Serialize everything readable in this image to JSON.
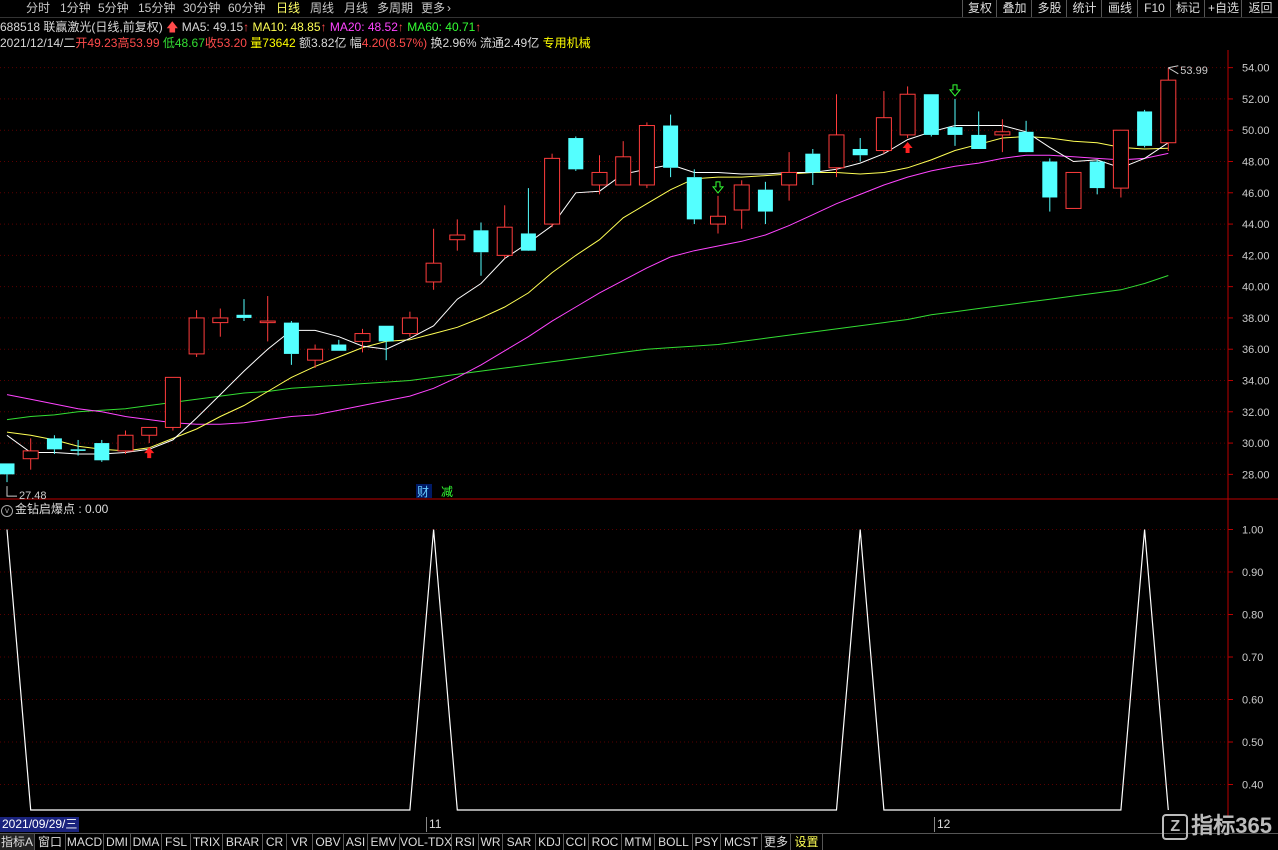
{
  "topbar": {
    "timeframes": [
      "分时",
      "1分钟",
      "5分钟",
      "15分钟",
      "30分钟",
      "60分钟",
      "日线",
      "周线",
      "月线",
      "多周期",
      "更多"
    ],
    "active_timeframe": "日线",
    "right_buttons": [
      "复权",
      "叠加",
      "多股",
      "统计",
      "画线",
      "F10",
      "标记",
      "+自选",
      "返回"
    ]
  },
  "info": {
    "code_name": "688518 联赢激光(日线,前复权)",
    "ma5": "MA5: 49.15",
    "ma10": "MA10: 48.85",
    "ma20": "MA20: 48.52",
    "ma60": "MA60: 40.71",
    "date": "2021/12/14/二",
    "open_label": "开",
    "open": "49.23",
    "high_label": "高",
    "high": "53.99",
    "low_label": "低",
    "low": "48.67",
    "close_label": "收",
    "close": "53.20",
    "vol_label": "量",
    "vol": "73642",
    "amt_label": "额",
    "amt": "3.82亿",
    "chg_label": "幅",
    "chg": "4.20(8.57%)",
    "turn_label": "换",
    "turn": "2.96%",
    "float_label": "流通",
    "float": "2.49亿",
    "industry": "专用机械"
  },
  "markers": {
    "cai": "财",
    "jian": "减",
    "max_label": "53.99",
    "min_label": "27.48"
  },
  "indicator": {
    "title": "金钻启爆点 : 0.00"
  },
  "datebar": {
    "start_date": "2021/09/29/三",
    "month_11": "11",
    "month_12": "12"
  },
  "bottombar": {
    "tabs": [
      "指标A",
      "窗口",
      "MACD",
      "DMI",
      "DMA",
      "FSL",
      "TRIX",
      "BRAR",
      "CR",
      "VR",
      "OBV",
      "ASI",
      "EMV",
      "VOL-TDX",
      "RSI",
      "WR",
      "SAR",
      "KDJ",
      "CCI",
      "ROC",
      "MTM",
      "BOLL",
      "PSY",
      "MCST",
      "更多",
      "设置"
    ],
    "watermark": "指标365"
  },
  "colors": {
    "up": "#ff3c3c",
    "down": "#54ffff",
    "ma5": "#ffffff",
    "ma10": "#ffff55",
    "ma20": "#ff44ff",
    "ma60": "#33dd33"
  },
  "chart_data": [
    {
      "type": "candlestick",
      "ylim": [
        27,
        55
      ],
      "yticks": [
        "28.00",
        "30.00",
        "32.00",
        "34.00",
        "36.00",
        "38.00",
        "40.00",
        "42.00",
        "44.00",
        "46.00",
        "48.00",
        "50.00",
        "52.00",
        "54.00"
      ],
      "candles": [
        [
          28.7,
          28.7,
          27.5,
          28.0
        ],
        [
          29.0,
          30.3,
          28.3,
          29.5
        ],
        [
          30.3,
          30.5,
          29.3,
          29.6
        ],
        [
          29.6,
          30.2,
          29.2,
          29.5
        ],
        [
          30.0,
          30.2,
          28.8,
          28.9
        ],
        [
          29.5,
          30.8,
          29.3,
          30.5
        ],
        [
          30.5,
          31.0,
          30.0,
          31.0
        ],
        [
          31.0,
          34.2,
          30.8,
          34.2
        ],
        [
          35.7,
          38.5,
          35.5,
          38.0
        ],
        [
          37.7,
          38.6,
          36.8,
          38.0
        ],
        [
          38.2,
          39.2,
          37.8,
          38.0
        ],
        [
          37.7,
          39.4,
          36.5,
          37.8
        ],
        [
          37.7,
          37.8,
          35.0,
          35.7
        ],
        [
          35.3,
          36.3,
          34.8,
          36.0
        ],
        [
          36.3,
          36.6,
          35.9,
          35.9
        ],
        [
          36.5,
          37.3,
          35.8,
          37.0
        ],
        [
          37.5,
          37.5,
          35.3,
          36.5
        ],
        [
          37.0,
          38.4,
          36.8,
          38.0
        ],
        [
          40.3,
          43.7,
          39.8,
          41.5
        ],
        [
          43.0,
          44.3,
          42.3,
          43.3
        ],
        [
          43.6,
          44.1,
          40.7,
          42.2
        ],
        [
          42.0,
          45.2,
          41.8,
          43.8
        ],
        [
          43.4,
          46.3,
          42.8,
          42.3
        ],
        [
          44.0,
          48.5,
          43.8,
          48.2
        ],
        [
          49.5,
          49.6,
          47.4,
          47.5
        ],
        [
          46.5,
          48.4,
          45.9,
          47.3
        ],
        [
          46.5,
          49.3,
          46.5,
          48.3
        ],
        [
          46.5,
          50.5,
          46.3,
          50.3
        ],
        [
          50.3,
          51.0,
          47.0,
          47.6
        ],
        [
          47.0,
          47.5,
          44.0,
          44.3
        ],
        [
          44.0,
          45.8,
          43.4,
          44.5
        ],
        [
          44.9,
          46.8,
          43.7,
          46.5
        ],
        [
          46.2,
          46.7,
          44.0,
          44.8
        ],
        [
          46.5,
          48.6,
          45.5,
          47.3
        ],
        [
          48.5,
          48.8,
          46.5,
          47.3
        ],
        [
          47.6,
          52.3,
          47.0,
          49.7
        ],
        [
          48.8,
          49.5,
          48.0,
          48.4
        ],
        [
          48.7,
          52.5,
          48.5,
          50.8
        ],
        [
          49.7,
          52.8,
          49.5,
          52.3
        ],
        [
          52.3,
          52.3,
          49.6,
          49.7
        ],
        [
          50.2,
          52.0,
          49.0,
          49.7
        ],
        [
          49.7,
          51.2,
          49.0,
          48.8
        ],
        [
          49.7,
          50.7,
          48.6,
          49.9
        ],
        [
          49.9,
          50.6,
          48.7,
          48.6
        ],
        [
          48.0,
          48.2,
          44.8,
          45.7
        ],
        [
          45.0,
          47.3,
          45.0,
          47.3
        ],
        [
          48.0,
          48.1,
          45.9,
          46.3
        ],
        [
          46.3,
          50.0,
          45.7,
          50.0
        ],
        [
          51.2,
          51.3,
          48.9,
          49.0
        ],
        [
          49.2,
          53.99,
          48.67,
          53.2
        ]
      ],
      "ma5": [
        30.5,
        29.4,
        29.4,
        29.3,
        29.3,
        29.4,
        29.6,
        30.2,
        31.6,
        33.1,
        34.6,
        36.0,
        37.2,
        37.2,
        36.8,
        36.2,
        36.0,
        36.7,
        37.5,
        39.2,
        40.2,
        41.8,
        42.8,
        43.9,
        46.0,
        46.1,
        47.2,
        47.5,
        47.8,
        47.3,
        47.3,
        47.2,
        47.2,
        47.3,
        47.3,
        47.5,
        47.9,
        48.5,
        49.4,
        49.9,
        50.3,
        50.3,
        50.3,
        49.9,
        48.9,
        48.0,
        48.1,
        47.6,
        48.2,
        49.2
      ],
      "ma10": [
        30.7,
        30.5,
        30.2,
        29.8,
        29.6,
        29.5,
        29.7,
        30.3,
        30.9,
        31.7,
        32.4,
        33.3,
        34.2,
        34.9,
        35.5,
        36.1,
        36.5,
        36.6,
        37.0,
        37.4,
        38.0,
        38.7,
        39.6,
        40.9,
        42.0,
        43.0,
        44.4,
        45.3,
        46.2,
        46.9,
        47.0,
        47.0,
        47.1,
        47.2,
        47.3,
        47.3,
        47.2,
        47.3,
        47.6,
        48.1,
        48.7,
        49.1,
        49.5,
        49.6,
        49.5,
        49.3,
        49.2,
        48.9,
        48.8,
        48.85
      ],
      "ma20": [
        33.1,
        32.8,
        32.5,
        32.2,
        32.0,
        31.7,
        31.5,
        31.3,
        31.2,
        31.2,
        31.3,
        31.5,
        31.7,
        31.8,
        32.1,
        32.4,
        32.7,
        33.0,
        33.5,
        34.2,
        35.0,
        35.9,
        36.8,
        37.8,
        38.7,
        39.6,
        40.4,
        41.2,
        41.9,
        42.3,
        42.6,
        42.9,
        43.3,
        43.9,
        44.6,
        45.3,
        45.9,
        46.5,
        47.0,
        47.4,
        47.7,
        47.9,
        48.2,
        48.4,
        48.4,
        48.3,
        48.2,
        48.1,
        48.2,
        48.52
      ],
      "ma60": [
        31.5,
        31.7,
        31.8,
        32.0,
        32.1,
        32.2,
        32.4,
        32.6,
        32.8,
        33.0,
        33.2,
        33.3,
        33.5,
        33.6,
        33.7,
        33.8,
        33.9,
        34.0,
        34.2,
        34.4,
        34.6,
        34.8,
        35.0,
        35.2,
        35.4,
        35.6,
        35.8,
        36.0,
        36.1,
        36.2,
        36.3,
        36.5,
        36.7,
        36.9,
        37.1,
        37.3,
        37.5,
        37.7,
        37.9,
        38.2,
        38.4,
        38.6,
        38.8,
        39.0,
        39.2,
        39.4,
        39.6,
        39.8,
        40.2,
        40.71
      ],
      "up_arrows": [
        6,
        38
      ],
      "down_arrows": [
        30,
        40
      ]
    },
    {
      "type": "line",
      "name": "金钻启爆点",
      "ylim": [
        0.34,
        1.02
      ],
      "yticks": [
        "0.40",
        "0.50",
        "0.60",
        "0.70",
        "0.80",
        "0.90",
        "1.00"
      ],
      "values": [
        1,
        0,
        0,
        0,
        0,
        0,
        0,
        0,
        0,
        0,
        0,
        0,
        0,
        0,
        0,
        0,
        0,
        0,
        1,
        0,
        0,
        0,
        0,
        0,
        0,
        0,
        0,
        0,
        0,
        0,
        0,
        0,
        0,
        0,
        0,
        0,
        1,
        0,
        0,
        0,
        0,
        0,
        0,
        0,
        0,
        0,
        0,
        0,
        1,
        0
      ]
    }
  ]
}
